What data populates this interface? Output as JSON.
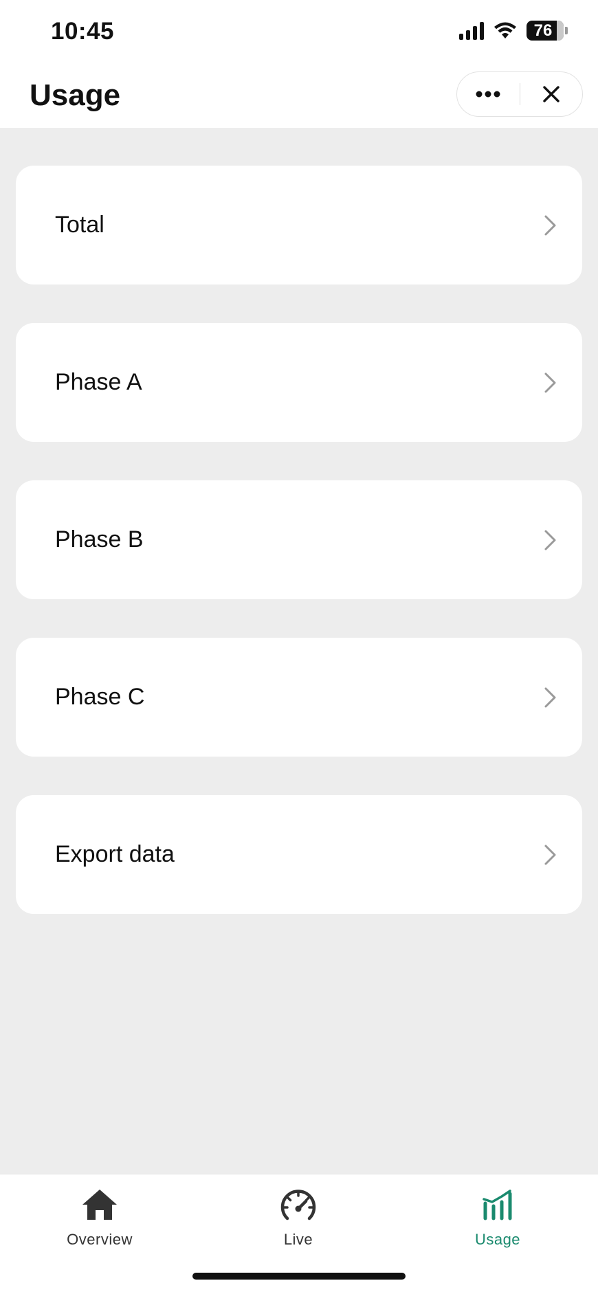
{
  "status_bar": {
    "time": "10:45",
    "battery": "76"
  },
  "header": {
    "title": "Usage",
    "more_icon": "ellipsis-icon",
    "close_icon": "close-icon"
  },
  "menu": {
    "items": [
      {
        "label": "Total"
      },
      {
        "label": "Phase A"
      },
      {
        "label": "Phase B"
      },
      {
        "label": "Phase C"
      },
      {
        "label": "Export data"
      }
    ]
  },
  "tabs": [
    {
      "label": "Overview",
      "icon": "home-icon",
      "active": false
    },
    {
      "label": "Live",
      "icon": "speedometer-icon",
      "active": false
    },
    {
      "label": "Usage",
      "icon": "bar-chart-icon",
      "active": true
    }
  ],
  "colors": {
    "accent": "#1a8a6e",
    "inactive_tab": "#333333",
    "background": "#ededed",
    "card": "#ffffff",
    "chevron": "#9a9a9a"
  }
}
